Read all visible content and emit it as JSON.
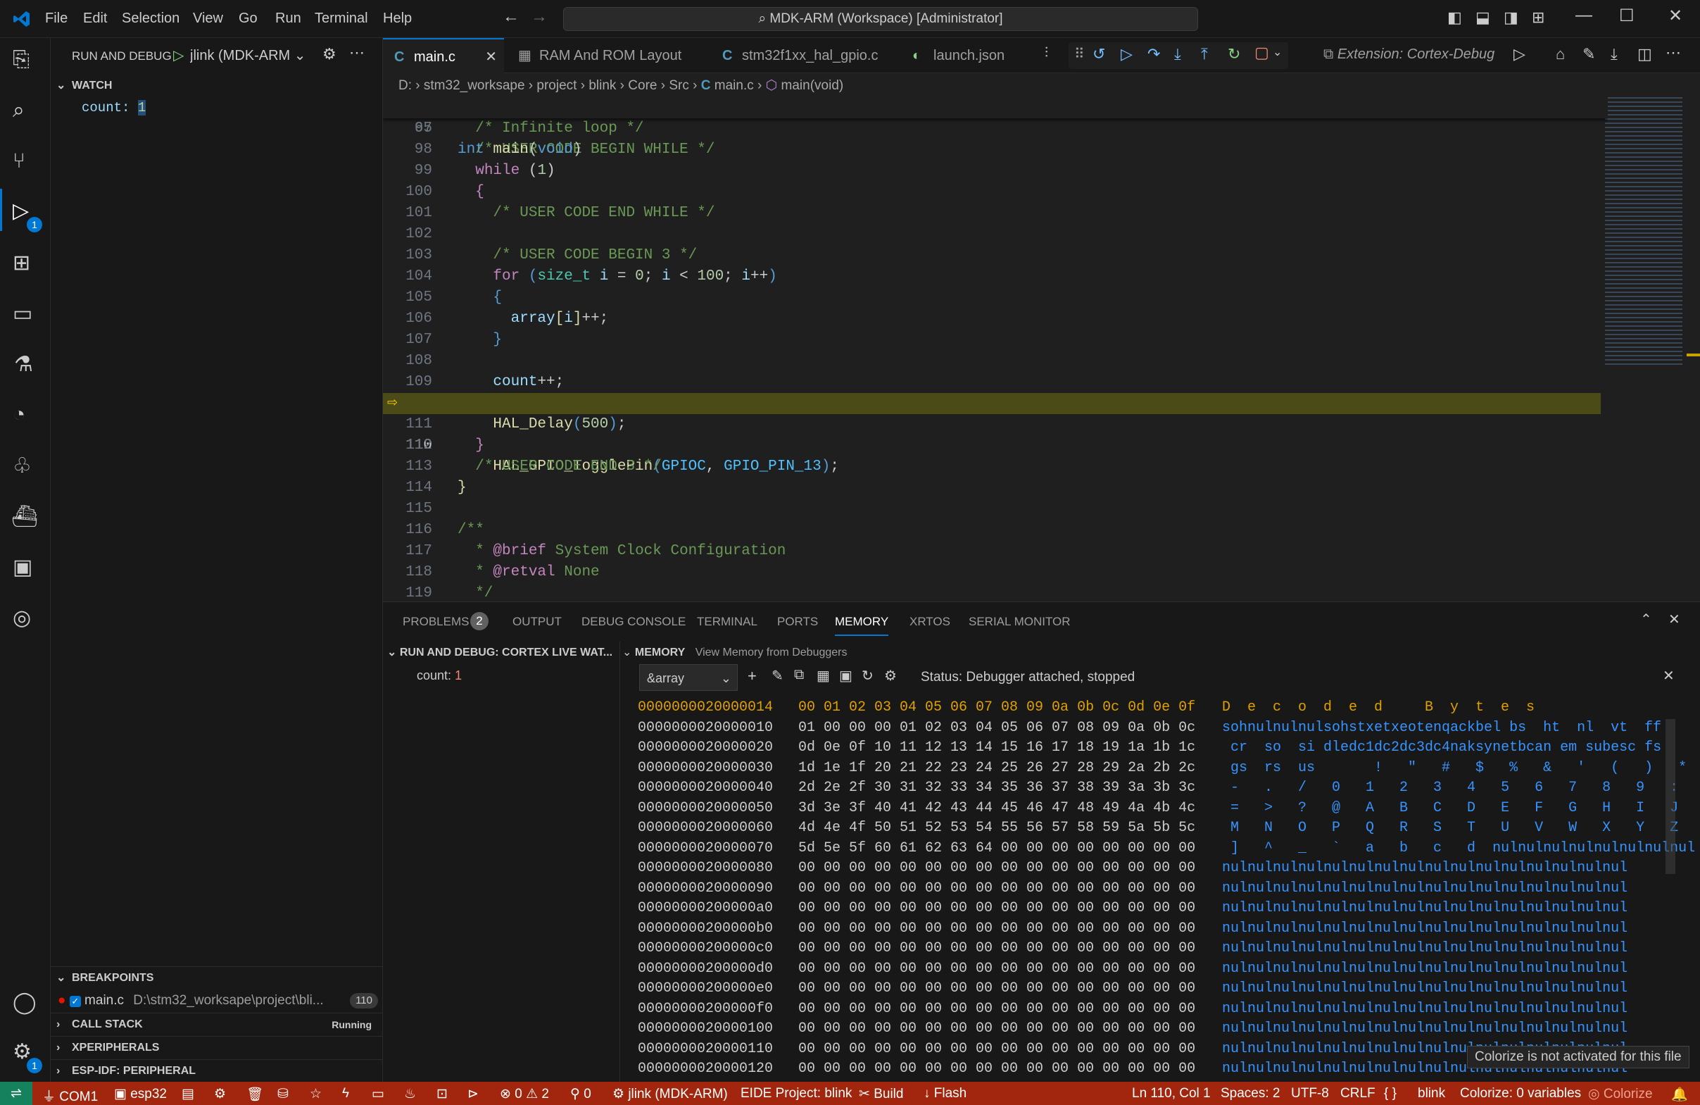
{
  "menu": [
    "File",
    "Edit",
    "Selection",
    "View",
    "Go",
    "Run",
    "Terminal",
    "Help"
  ],
  "title": "MDK-ARM (Workspace) [Administrator]",
  "sidebar": {
    "header": "RUN AND DEBUG",
    "config": "jlink (MDK-ARM",
    "watch_title": "WATCH",
    "watch_name": "count:",
    "watch_value": "1",
    "breakpoints_title": "BREAKPOINTS",
    "bp_file": "main.c",
    "bp_path": "D:\\stm32_worksape\\project\\bli...",
    "bp_line": "110",
    "call_stack": "CALL STACK",
    "call_stack_status": "Running",
    "xperipherals": "XPERIPHERALS",
    "esp_idf": "ESP-IDF: PERIPHERAL"
  },
  "tabs": [
    "main.c",
    "RAM And ROM Layout",
    "stm32f1xx_hal_gpio.c",
    "launch.json"
  ],
  "tab_extension": "Extension: Cortex-Debug",
  "breadcrumb": [
    "D:",
    "stm32_worksape",
    "project",
    "blink",
    "Core",
    "Src",
    "main.c",
    "main(void)"
  ],
  "code_header": {
    "ln": "65",
    "text": "int main(void)"
  },
  "panel": {
    "tabs": [
      "PROBLEMS",
      "OUTPUT",
      "DEBUG CONSOLE",
      "TERMINAL",
      "PORTS",
      "MEMORY",
      "XRTOS",
      "SERIAL MONITOR"
    ],
    "problems_count": "2",
    "live_watch_title": "RUN AND DEBUG: CORTEX LIVE WAT...",
    "live_name": "count:",
    "live_value": "1",
    "memory_title": "MEMORY",
    "memory_sub": "View Memory from Debuggers",
    "memory_expr": "&array",
    "status": "Status: Debugger attached, stopped",
    "header_addr": "0000000020000014",
    "header_hex": "00 01 02 03 04 05 06 07 08 09 0a 0b 0c 0d 0e 0f",
    "header_dec": "D e c o d e d   B y t e s",
    "rows": [
      {
        "addr": "0000000020000010",
        "hex": "01 00 00 00 01 02 03 04 05 06 07 08 09 0a 0b 0c",
        "dec": "sohnulnulnulsohstxetxeotenqackbel bs  ht  nl  vt  ff"
      },
      {
        "addr": "0000000020000020",
        "hex": "0d 0e 0f 10 11 12 13 14 15 16 17 18 19 1a 1b 1c",
        "dec": " cr  so  si dledc1dc2dc3dc4naksynetbcan em subesc fs"
      },
      {
        "addr": "0000000020000030",
        "hex": "1d 1e 1f 20 21 22 23 24 25 26 27 28 29 2a 2b 2c",
        "dec": " gs  rs  us       !   \"   #   $   %   &   '   (   )   *   +   ,"
      },
      {
        "addr": "0000000020000040",
        "hex": "2d 2e 2f 30 31 32 33 34 35 36 37 38 39 3a 3b 3c",
        "dec": " -   .   /   0   1   2   3   4   5   6   7   8   9   :   ;   <"
      },
      {
        "addr": "0000000020000050",
        "hex": "3d 3e 3f 40 41 42 43 44 45 46 47 48 49 4a 4b 4c",
        "dec": " =   >   ?   @   A   B   C   D   E   F   G   H   I   J   K   L"
      },
      {
        "addr": "0000000020000060",
        "hex": "4d 4e 4f 50 51 52 53 54 55 56 57 58 59 5a 5b 5c",
        "dec": " M   N   O   P   Q   R   S   T   U   V   W   X   Y   Z   [   \\"
      },
      {
        "addr": "0000000020000070",
        "hex": "5d 5e 5f 60 61 62 63 64 00 00 00 00 00 00 00 00",
        "dec": " ]   ^   _   `   a   b   c   d  nulnulnulnulnulnulnulnul"
      },
      {
        "addr": "0000000020000080",
        "hex": "00 00 00 00 00 00 00 00 00 00 00 00 00 00 00 00",
        "dec": "nulnulnulnulnulnulnulnulnulnulnulnulnulnulnulnul"
      },
      {
        "addr": "0000000020000090",
        "hex": "00 00 00 00 00 00 00 00 00 00 00 00 00 00 00 00",
        "dec": "nulnulnulnulnulnulnulnulnulnulnulnulnulnulnulnul"
      },
      {
        "addr": "00000000200000a0",
        "hex": "00 00 00 00 00 00 00 00 00 00 00 00 00 00 00 00",
        "dec": "nulnulnulnulnulnulnulnulnulnulnulnulnulnulnulnul"
      },
      {
        "addr": "00000000200000b0",
        "hex": "00 00 00 00 00 00 00 00 00 00 00 00 00 00 00 00",
        "dec": "nulnulnulnulnulnulnulnulnulnulnulnulnulnulnulnul"
      },
      {
        "addr": "00000000200000c0",
        "hex": "00 00 00 00 00 00 00 00 00 00 00 00 00 00 00 00",
        "dec": "nulnulnulnulnulnulnulnulnulnulnulnulnulnulnulnul"
      },
      {
        "addr": "00000000200000d0",
        "hex": "00 00 00 00 00 00 00 00 00 00 00 00 00 00 00 00",
        "dec": "nulnulnulnulnulnulnulnulnulnulnulnulnulnulnulnul"
      },
      {
        "addr": "00000000200000e0",
        "hex": "00 00 00 00 00 00 00 00 00 00 00 00 00 00 00 00",
        "dec": "nulnulnulnulnulnulnulnulnulnulnulnulnulnulnulnul"
      },
      {
        "addr": "00000000200000f0",
        "hex": "00 00 00 00 00 00 00 00 00 00 00 00 00 00 00 00",
        "dec": "nulnulnulnulnulnulnulnulnulnulnulnulnulnulnulnul"
      },
      {
        "addr": "0000000020000100",
        "hex": "00 00 00 00 00 00 00 00 00 00 00 00 00 00 00 00",
        "dec": "nulnulnulnulnulnulnulnulnulnulnulnulnulnulnulnul"
      },
      {
        "addr": "0000000020000110",
        "hex": "00 00 00 00 00 00 00 00 00 00 00 00 00 00 00 00",
        "dec": "nulnulnulnulnulnulnulnulnulnulnulnulnulnulnulnul"
      },
      {
        "addr": "0000000020000120",
        "hex": "00 00 00 00 00 00 00 00 00 00 00 00 00 00 00 00",
        "dec": "nulnulnulnulnulnulnulnulnulnulnulnulnulnulnulnul"
      }
    ],
    "tooltip": "Colorize is not activated for this file"
  },
  "status": {
    "com": "COM1",
    "esp": "esp32",
    "problems_err": "0",
    "problems_warn": "2",
    "ports": "0",
    "debug": "jlink (MDK-ARM)",
    "eide": "EIDE Project: blink",
    "build": "Build",
    "flash": "Flash",
    "pos": "Ln 110, Col 1",
    "spaces": "Spaces: 2",
    "enc": "UTF-8",
    "eol": "CRLF",
    "lang": "{ }",
    "proj": "blink",
    "colorize": "Colorize: 0 variables",
    "colorize2": "Colorize"
  },
  "colors": {
    "accent": "#0078d4",
    "statusbar": "#a1260d",
    "current_line": "#4b4b18"
  }
}
